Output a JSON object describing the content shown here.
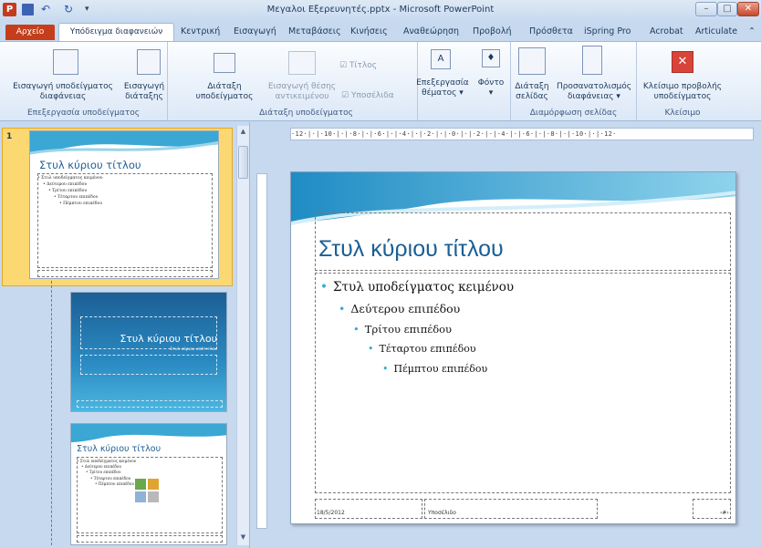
{
  "window": {
    "title": "Μεγαλοι Εξερευνητές.pptx - Microsoft PowerPoint",
    "app_icon": "P"
  },
  "tabs": {
    "file": "Αρχείο",
    "active": "Υπόδειγμα διαφανειών",
    "others": [
      "Κεντρική",
      "Εισαγωγή",
      "Μεταβάσεις",
      "Κινήσεις",
      "Αναθεώρηση",
      "Προβολή",
      "Πρόσθετα",
      "iSpring Pro",
      "Acrobat",
      "Articulate"
    ]
  },
  "ribbon": {
    "groups": [
      {
        "label": "Επεξεργασία υποδείγματος",
        "buttons": [
          [
            "Εισαγωγή υποδείγματος",
            "διαφάνειας"
          ],
          [
            "Εισαγωγή",
            "διάταξης"
          ]
        ]
      },
      {
        "label": "Διάταξη υποδείγματος",
        "buttons": [
          [
            "Διάταξη",
            "υποδείγματος"
          ],
          [
            "Εισαγωγή θέσης",
            "αντικειμένου"
          ]
        ],
        "checks": [
          "Τίτλος",
          "Υποσέλιδα"
        ]
      },
      {
        "label": "",
        "buttons": [
          [
            "Επεξεργασία",
            "θέματος"
          ],
          [
            "Φόντο",
            ""
          ]
        ]
      },
      {
        "label": "Διαμόρφωση σελίδας",
        "buttons": [
          [
            "Διάταξη",
            "σελίδας"
          ],
          [
            "Προσανατολισμός",
            "διαφάνειας"
          ]
        ]
      },
      {
        "label": "Κλείσιμο",
        "buttons": [
          [
            "Κλείσιμο προβολής",
            "υποδείγματος"
          ]
        ]
      }
    ]
  },
  "thumbnails": {
    "slide_number": "1",
    "t1_title": "Στυλ κύριου τίτλου",
    "t1_lines": [
      "• Στυλ υποδείγματος κειμένου",
      "• Δεύτερου επιπέδου",
      "• Τρίτου επιπέδου",
      "• Τέταρτου επιπέδου",
      "• Πέμπτου επιπέδου"
    ],
    "t2_title": "Στυλ κύριου τίτλου",
    "t2_sub": "Στυλ κύριου υπότιτλου",
    "t3_title": "Στυλ κύριου τίτλου",
    "t3_lines": [
      "• Στυλ υποδείγματος κειμένου",
      "• Δεύτερου επιπέδου",
      "• Τρίτου επιπέδου",
      "• Τέταρτου επιπέδου",
      "• Πέμπτου επιπέδου"
    ]
  },
  "ruler": {
    "text": "·12·|·|·10·|·|·8·|·|·6·|·|·4·|·|·2·|·|·0·|·|·2·|·|·4·|·|·6·|·|·8·|·|·10·|·|·12·"
  },
  "slide": {
    "title": "Στυλ κύριου τίτλου",
    "bullets": [
      "Στυλ υποδείγματος κειμένου",
      "Δεύτερου επιπέδου",
      "Τρίτου επιπέδου",
      "Τέταρτου επιπέδου",
      "Πέμπτου επιπέδου"
    ],
    "footer_date": "18/5/2012",
    "footer_text": "Υποσέλιδο",
    "footer_num": "‹#›"
  },
  "colors": {
    "accent": "#33a9d9",
    "file_tab": "#c43e1c",
    "selected_thumb": "#fcd873"
  }
}
